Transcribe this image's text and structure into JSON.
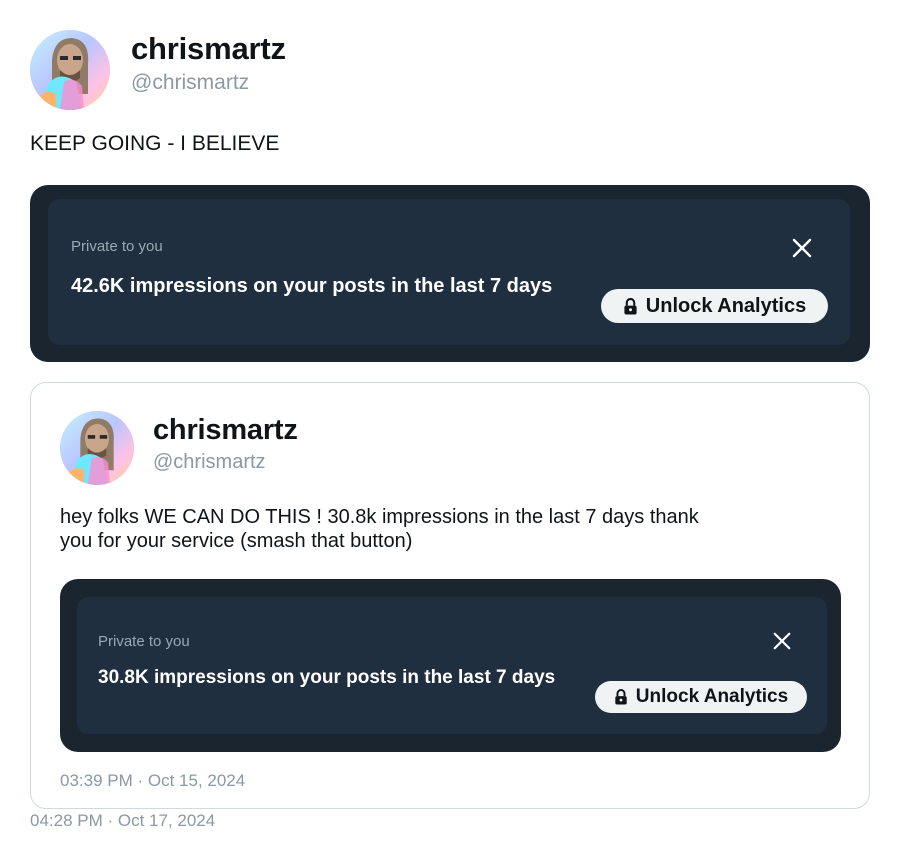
{
  "main_post": {
    "author_name": "chrismartz",
    "author_handle": "@chrismartz",
    "text": "KEEP GOING - I BELIEVE",
    "card": {
      "private_label": "Private to you",
      "impressions_text": "42.6K impressions on your posts in the last 7 days",
      "unlock_label": "Unlock Analytics",
      "close_icon": "close-icon",
      "lock_icon": "lock-icon"
    },
    "timestamp": "04:28 PM · Oct 17, 2024"
  },
  "quoted_post": {
    "author_name": "chrismartz",
    "author_handle": "@chrismartz",
    "text_line1": "hey folks WE CAN DO THIS ! 30.8k impressions in the last 7 days thank",
    "text_line2": "you for your service (smash that button)",
    "card": {
      "private_label": "Private to you",
      "impressions_text": "30.8K impressions on your posts in the last 7 days",
      "unlock_label": "Unlock Analytics",
      "close_icon": "close-icon",
      "lock_icon": "lock-icon"
    },
    "timestamp": "03:39 PM · Oct 15, 2024"
  },
  "colors": {
    "card_outer": "#1b2530",
    "card_inner": "#202f3f",
    "button_bg": "#eff3f4",
    "muted_text": "#8b98a5"
  }
}
